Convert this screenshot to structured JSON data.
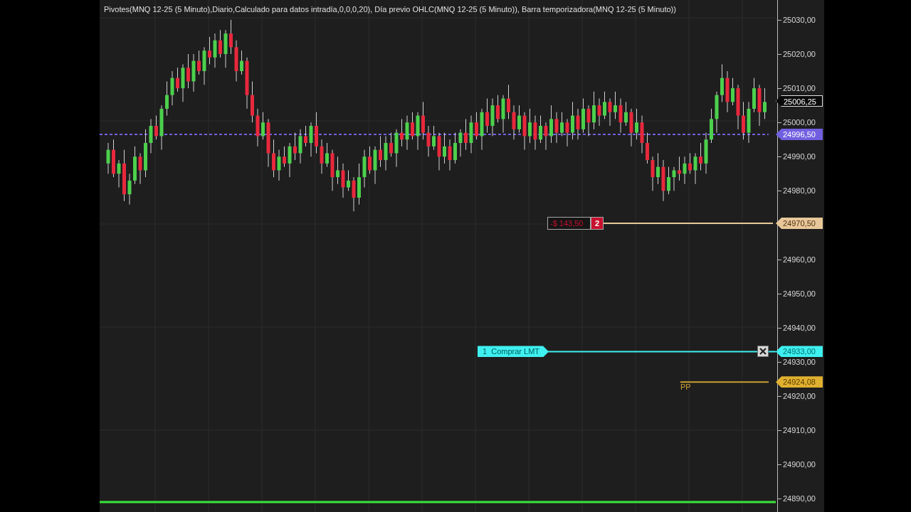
{
  "legend": "Pivotes(MNQ 12-25 (5 Minuto),Diario,Calculado para datos intradía,0,0,0,20), Día previo OHLC(MNQ 12-25 (5 Minuto)), Barra temporizadora(MNQ 12-25 (5 Minuto))",
  "chart_data": {
    "type": "candlestick",
    "ylim": [
      24886.1,
      25035.8
    ],
    "grid": true,
    "ref_lines": [
      {
        "axis": "y",
        "value": 24996.5,
        "color": "#7060e0"
      },
      {
        "axis": "y",
        "value": 24970.5,
        "color": "#e8c89a"
      },
      {
        "axis": "y",
        "value": 24933,
        "color": "#3ff0f0"
      },
      {
        "axis": "y",
        "value": 24924.08,
        "color": "#c8a030"
      },
      {
        "axis": "y",
        "value": 24889,
        "color": "#39e639"
      }
    ],
    "yticks": [
      {
        "value": 25030,
        "label": "25030,00"
      },
      {
        "value": 25020,
        "label": "25020,00"
      },
      {
        "value": 25010,
        "label": "25010,00"
      },
      {
        "value": 25000,
        "label": "25000,00"
      },
      {
        "value": 24990,
        "label": "24990,00"
      },
      {
        "value": 24980,
        "label": "24980,00"
      },
      {
        "value": 24960,
        "label": "24960,00"
      },
      {
        "value": 24950,
        "label": "24950,00"
      },
      {
        "value": 24940,
        "label": "24940,00"
      },
      {
        "value": 24930,
        "label": "24930,00"
      },
      {
        "value": 24920,
        "label": "24920,00"
      },
      {
        "value": 24910,
        "label": "24910,00"
      },
      {
        "value": 24900,
        "label": "24900,00"
      },
      {
        "value": 24890,
        "label": "24890,00"
      }
    ],
    "ohlc": [
      [
        24988,
        24994,
        24985,
        24992
      ],
      [
        24992,
        24995,
        24984,
        24985
      ],
      [
        24985,
        24989,
        24981,
        24988
      ],
      [
        24988,
        24992,
        24977,
        24979
      ],
      [
        24979,
        24985,
        24976,
        24983
      ],
      [
        24983,
        24993,
        24982,
        24990
      ],
      [
        24990,
        24991,
        24982,
        24986
      ],
      [
        24986,
        24998,
        24984,
        24994
      ],
      [
        24994,
        25001,
        24991,
        24999
      ],
      [
        24999,
        25002,
        24995,
        24996
      ],
      [
        24996,
        25005,
        24992,
        25004
      ],
      [
        25004,
        25012,
        25002,
        25008
      ],
      [
        25008,
        25015,
        25005,
        25013
      ],
      [
        25013,
        25016,
        25009,
        25010
      ],
      [
        25010,
        25017,
        25006,
        25016
      ],
      [
        25016,
        25020,
        25010,
        25012
      ],
      [
        25012,
        25020,
        25009,
        25018
      ],
      [
        25018,
        25021,
        25014,
        25015
      ],
      [
        25015,
        25022,
        25011,
        25021
      ],
      [
        25021,
        25025,
        25017,
        25019
      ],
      [
        25019,
        25026,
        25016,
        25024
      ],
      [
        25024,
        25027,
        25019,
        25020
      ],
      [
        25020,
        25027,
        25016,
        25026
      ],
      [
        25026,
        25030,
        25020,
        25022
      ],
      [
        25022,
        25024,
        25012,
        25015
      ],
      [
        25015,
        25021,
        25014,
        25018
      ],
      [
        25018,
        25019,
        25004,
        25008
      ],
      [
        25008,
        25012,
        25000,
        25002
      ],
      [
        25002,
        25004,
        24993,
        24996
      ],
      [
        24996,
        25003,
        24995,
        25000
      ],
      [
        25000,
        25001,
        24987,
        24991
      ],
      [
        24991,
        24995,
        24984,
        24986
      ],
      [
        24986,
        24992,
        24983,
        24990
      ],
      [
        24990,
        24993,
        24987,
        24988
      ],
      [
        24988,
        24994,
        24984,
        24993
      ],
      [
        24993,
        24997,
        24989,
        24991
      ],
      [
        24991,
        24998,
        24988,
        24996
      ],
      [
        24996,
        24999,
        24993,
        24994
      ],
      [
        24994,
        25000,
        24990,
        24999
      ],
      [
        24999,
        25003,
        24991,
        24993
      ],
      [
        24993,
        24995,
        24985,
        24988
      ],
      [
        24988,
        24994,
        24987,
        24991
      ],
      [
        24991,
        24992,
        24980,
        24984
      ],
      [
        24984,
        24990,
        24982,
        24986
      ],
      [
        24986,
        24988,
        24978,
        24981
      ],
      [
        24981,
        24986,
        24980,
        24983
      ],
      [
        24983,
        24984,
        24974,
        24978
      ],
      [
        24978,
        24988,
        24976,
        24984
      ],
      [
        24984,
        24992,
        24981,
        24990
      ],
      [
        24990,
        24993,
        24985,
        24986
      ],
      [
        24986,
        24993,
        24982,
        24992
      ],
      [
        24992,
        24996,
        24987,
        24989
      ],
      [
        24989,
        24996,
        24986,
        24994
      ],
      [
        24994,
        24997,
        24990,
        24991
      ],
      [
        24991,
        24998,
        24987,
        24997
      ],
      [
        24997,
        25001,
        24993,
        24995
      ],
      [
        24995,
        25002,
        24992,
        25000
      ],
      [
        25000,
        25003,
        24995,
        24996
      ],
      [
        24996,
        25003,
        24992,
        25002
      ],
      [
        25002,
        25006,
        24995,
        24997
      ],
      [
        24997,
        24999,
        24990,
        24993
      ],
      [
        24993,
        24999,
        24992,
        24996
      ],
      [
        24996,
        24997,
        24986,
        24990
      ],
      [
        24990,
        24997,
        24988,
        24993
      ],
      [
        24993,
        24995,
        24986,
        24989
      ],
      [
        24989,
        24997,
        24988,
        24994
      ],
      [
        24994,
        24998,
        24990,
        24997
      ],
      [
        24997,
        25001,
        24992,
        24994
      ],
      [
        24994,
        25002,
        24991,
        25000
      ],
      [
        25000,
        25003,
        24995,
        24996
      ],
      [
        24996,
        25004,
        24992,
        25003
      ],
      [
        25003,
        25007,
        24997,
        24999
      ],
      [
        24999,
        25007,
        24996,
        25005
      ],
      [
        25005,
        25008,
        25000,
        25001
      ],
      [
        25001,
        25008,
        24997,
        25007
      ],
      [
        25007,
        25011,
        25001,
        25003
      ],
      [
        25003,
        25005,
        24995,
        24998
      ],
      [
        24998,
        25005,
        24997,
        25002
      ],
      [
        25002,
        25003,
        24992,
        24996
      ],
      [
        24996,
        25004,
        24994,
        25000
      ],
      [
        25000,
        25002,
        24992,
        24995
      ],
      [
        24995,
        25002,
        24994,
        24999
      ],
      [
        24999,
        25000,
        24992,
        24996
      ],
      [
        24996,
        25005,
        24994,
        25001
      ],
      [
        25001,
        25003,
        24994,
        24997
      ],
      [
        24997,
        25003,
        24996,
        25000
      ],
      [
        25000,
        25001,
        24993,
        24997
      ],
      [
        24997,
        25006,
        24995,
        25002
      ],
      [
        25002,
        25004,
        24995,
        24998
      ],
      [
        24998,
        25007,
        24997,
        25004
      ],
      [
        25004,
        25005,
        24996,
        25000
      ],
      [
        25000,
        25009,
        24998,
        25005
      ],
      [
        25005,
        25007,
        24999,
        25002
      ],
      [
        25002,
        25009,
        25001,
        25006
      ],
      [
        25006,
        25007,
        24999,
        25003
      ],
      [
        25003,
        25009,
        25001,
        25005
      ],
      [
        25005,
        25007,
        24997,
        25000
      ],
      [
        25000,
        25006,
        24999,
        25003
      ],
      [
        25003,
        25004,
        24993,
        24997
      ],
      [
        24997,
        25004,
        24995,
        25000
      ],
      [
        25000,
        25002,
        24991,
        24994
      ],
      [
        24994,
        24997,
        24988,
        24989
      ],
      [
        24989,
        24990,
        24980,
        24984
      ],
      [
        24984,
        24991,
        24982,
        24987
      ],
      [
        24987,
        24989,
        24977,
        24980
      ],
      [
        24980,
        24987,
        24979,
        24984
      ],
      [
        24984,
        24987,
        24980,
        24986
      ],
      [
        24986,
        24990,
        24983,
        24985
      ],
      [
        24985,
        24990,
        24982,
        24988
      ],
      [
        24988,
        24991,
        24985,
        24986
      ],
      [
        24986,
        24991,
        24982,
        24990
      ],
      [
        24990,
        24994,
        24986,
        24988
      ],
      [
        24988,
        24997,
        24985,
        24995
      ],
      [
        24995,
        25004,
        24994,
        25001
      ],
      [
        25001,
        25009,
        24997,
        25008
      ],
      [
        25008,
        25017,
        25006,
        25013
      ],
      [
        25013,
        25015,
        25003,
        25006
      ],
      [
        25006,
        25013,
        25005,
        25010
      ],
      [
        25010,
        25011,
        24998,
        25002
      ],
      [
        25002,
        25006,
        24995,
        24997
      ],
      [
        24997,
        25006,
        24994,
        25004
      ],
      [
        25004,
        25013,
        25003,
        25010
      ],
      [
        25010,
        25011,
        24999,
        25003
      ],
      [
        25003,
        25010,
        25001,
        25006
      ]
    ]
  },
  "lines": [
    {
      "kind": "last",
      "price": "25006,25"
    },
    {
      "kind": "dashed",
      "price": "24996,50",
      "color": "#7060e0"
    },
    {
      "kind": "position",
      "price": "24970,50",
      "pnl": "-$ 143,50",
      "quantity": "2"
    },
    {
      "kind": "order",
      "price": "24933,00",
      "label": "1  Comprar LMT"
    },
    {
      "kind": "pivot",
      "price": "24924,08",
      "label": "PP"
    }
  ]
}
